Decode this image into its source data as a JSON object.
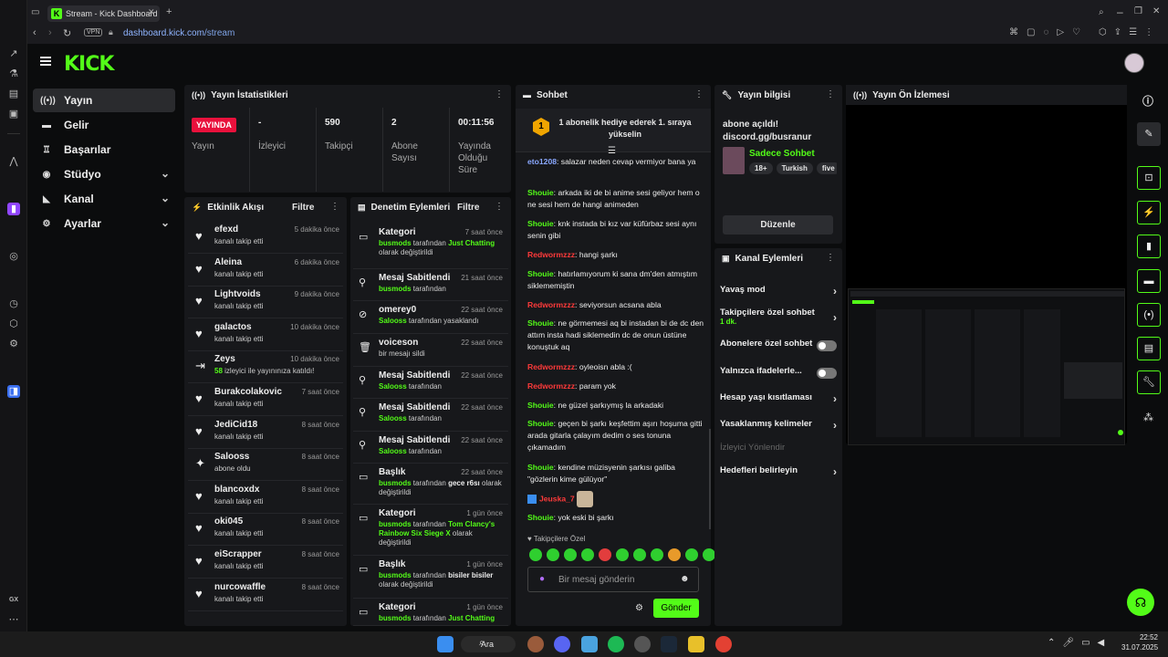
{
  "browser": {
    "tab_title": "Stream - Kick Dashboard",
    "url_domain": "dashboard.kick.com",
    "url_path": "/stream",
    "vpn": "VPN"
  },
  "brand": {
    "logo": "KICK",
    "accent": "#53fc18"
  },
  "sidebar": {
    "items": [
      {
        "label": "Yayın",
        "icon": "broadcast-icon"
      },
      {
        "label": "Gelir",
        "icon": "money-icon"
      },
      {
        "label": "Başarılar",
        "icon": "trophy-icon"
      },
      {
        "label": "Stüdyo",
        "icon": "studio-icon"
      },
      {
        "label": "Kanal",
        "icon": "channel-icon"
      },
      {
        "label": "Ayarlar",
        "icon": "gear-icon"
      }
    ]
  },
  "stats": {
    "title": "Yayın İstatistikleri",
    "live_badge": "YAYINDA",
    "cells": [
      {
        "value": "",
        "label": "Yayın"
      },
      {
        "value": "-",
        "label": "İzleyici"
      },
      {
        "value": "590",
        "label": "Takipçi"
      },
      {
        "value": "2",
        "label": "Abone Sayısı"
      },
      {
        "value": "00:11:56",
        "label": "Yayında Olduğu Süre"
      }
    ]
  },
  "events": {
    "title": "Etkinlik Akışı",
    "filter": "Filtre",
    "rows": [
      {
        "name": "efexd",
        "time": "5 dakika önce",
        "sub": "kanalı takip etti"
      },
      {
        "name": "Aleina",
        "time": "6 dakika önce",
        "sub": "kanalı takip etti"
      },
      {
        "name": "Lightvoids",
        "time": "9 dakika önce",
        "sub": "kanalı takip etti"
      },
      {
        "name": "galactos",
        "time": "10 dakika önce",
        "sub": "kanalı takip etti"
      },
      {
        "name": "Zeys",
        "time": "10 dakika önce",
        "sub_hl": "58",
        "sub": "izleyici ile yayınınıza katıldı!"
      },
      {
        "name": "Burakcolakovic",
        "time": "7 saat önce",
        "sub": "kanalı takip etti"
      },
      {
        "name": "JediCid18",
        "time": "8 saat önce",
        "sub": "kanalı takip etti"
      },
      {
        "name": "Salooss",
        "time": "8 saat önce",
        "sub": "abone oldu"
      },
      {
        "name": "blancoxdx",
        "time": "8 saat önce",
        "sub": "kanalı takip etti"
      },
      {
        "name": "oki045",
        "time": "8 saat önce",
        "sub": "kanalı takip etti"
      },
      {
        "name": "eiScrapper",
        "time": "8 saat önce",
        "sub": "kanalı takip etti"
      },
      {
        "name": "nurcowaffle",
        "time": "8 saat önce",
        "sub": "kanalı takip etti"
      }
    ]
  },
  "mod": {
    "title": "Denetim Eylemleri",
    "filter": "Filtre",
    "rows": [
      {
        "name": "Kategori",
        "time": "7 saat önce",
        "who": "busmods",
        "rest": "tarafından",
        "hl": "Just Chatting",
        "tail": "olarak değiştirildi"
      },
      {
        "name": "Mesaj Sabitlendi",
        "time": "21 saat önce",
        "who": "busmods",
        "rest": "tarafından",
        "hl": "",
        "tail": ""
      },
      {
        "name": "omerey0",
        "time": "22 saat önce",
        "who": "Salooss",
        "rest": "tarafından yasaklandı",
        "hl": "",
        "tail": ""
      },
      {
        "name": "voiceson",
        "time": "22 saat önce",
        "who": "",
        "rest": "bir mesajı sildi",
        "hl": "",
        "tail": ""
      },
      {
        "name": "Mesaj Sabitlendi",
        "time": "22 saat önce",
        "who": "Salooss",
        "rest": "tarafından",
        "hl": "",
        "tail": ""
      },
      {
        "name": "Mesaj Sabitlendi",
        "time": "22 saat önce",
        "who": "Salooss",
        "rest": "tarafından",
        "hl": "",
        "tail": ""
      },
      {
        "name": "Mesaj Sabitlendi",
        "time": "22 saat önce",
        "who": "Salooss",
        "rest": "tarafından",
        "hl": "",
        "tail": ""
      },
      {
        "name": "Başlık",
        "time": "22 saat önce",
        "who": "busmods",
        "rest": "tarafından",
        "hl": "gece r6sı",
        "tail": "olarak değiştirildi"
      },
      {
        "name": "Kategori",
        "time": "1 gün önce",
        "who": "busmods",
        "rest": "tarafından",
        "hl": "Tom Clancy's Rainbow Six Siege X",
        "tail": "olarak değiştirildi"
      },
      {
        "name": "Başlık",
        "time": "1 gün önce",
        "who": "busmods",
        "rest": "tarafından",
        "hl": "bisiler bisiler",
        "tail": "olarak değiştirildi"
      },
      {
        "name": "Kategori",
        "time": "1 gün önce",
        "who": "busmods",
        "rest": "tarafından",
        "hl": "Just Chatting",
        "tail": ""
      }
    ]
  },
  "chat": {
    "title": "Sohbet",
    "pinned": "1 abonelik hediye ederek 1. sıraya yükselin",
    "rank": "1",
    "messages": [
      {
        "user": "eto1208",
        "color": "b",
        "text": "salazar neden cevap vermiyor bana ya"
      },
      {
        "user": "Shouie",
        "color": "u",
        "text": "arkada iki de bi anime sesi geliyor hem o ne sesi hem de hangi animeden"
      },
      {
        "user": "Shouie",
        "color": "u",
        "text": "knk instada bi kız var küfürbaz sesi aynı senin gibi"
      },
      {
        "user": "Redwormzzz",
        "color": "r",
        "text": "hangi şarkı"
      },
      {
        "user": "Shouie",
        "color": "u",
        "text": "hatırlamıyorum ki sana dm'den atmıştım siklememiştin"
      },
      {
        "user": "Redwormzzz",
        "color": "r",
        "text": "seviyorsun acsana abla"
      },
      {
        "user": "Shouie",
        "color": "u",
        "text": "ne görmemesi aq bi instadan bi de dc den attım insta hadi siklemedin dc de onun üstüne konuştuk aq"
      },
      {
        "user": "Redwormzzz",
        "color": "r",
        "text": "oyleoisn abla :("
      },
      {
        "user": "Redwormzzz",
        "color": "r",
        "text": "param yok"
      },
      {
        "user": "Shouie",
        "color": "u",
        "text": "ne güzel şarkıymış la arkadaki"
      },
      {
        "user": "Shouie",
        "color": "u",
        "text": "geçen bi şarkı keşfettim aşırı hoşuma gitti arada gitarla çalayım dedim o ses tonuna çıkamadım"
      },
      {
        "user": "Shouie",
        "color": "u",
        "text": "kendine müzisyenin şarkısı galiba \"gözlerin kime gülüyor\""
      },
      {
        "user": "Jeuska_7",
        "color": "r",
        "text": ""
      },
      {
        "user": "Shouie",
        "color": "u",
        "text": "yok eski bi şarkı"
      }
    ],
    "followers_only": "Takipçilere Özel",
    "placeholder": "Bir mesaj gönderin",
    "send": "Gönder"
  },
  "info": {
    "title": "Yayın bilgisi",
    "stream_title": "abone açıldı! discord.gg/busranur",
    "category": "Sadece Sohbet",
    "tags": [
      "18+",
      "Turkish",
      "five"
    ],
    "edit": "Düzenle"
  },
  "actions": {
    "title": "Kanal Eylemleri",
    "items": [
      {
        "label": "Yavaş mod",
        "kind": "arrow",
        "sub": ""
      },
      {
        "label": "Takipçilere özel sohbet",
        "kind": "arrow",
        "sub": "1 dk."
      },
      {
        "label": "Abonelere özel sohbet",
        "kind": "toggle",
        "sub": ""
      },
      {
        "label": "Yalnızca ifadelerle...",
        "kind": "toggle",
        "sub": ""
      },
      {
        "label": "Hesap yaşı kısıtlaması",
        "kind": "arrow",
        "sub": ""
      },
      {
        "label": "Yasaklanmış kelimeler",
        "kind": "arrow",
        "sub": ""
      },
      {
        "label": "İzleyici Yönlendir",
        "kind": "disabled",
        "sub": ""
      },
      {
        "label": "Hedefleri belirleyin",
        "kind": "arrow",
        "sub": ""
      }
    ]
  },
  "preview": {
    "title": "Yayın Ön İzlemesi"
  },
  "taskbar": {
    "search": "Ara",
    "time": "22:52",
    "date": "31.07.2025"
  }
}
